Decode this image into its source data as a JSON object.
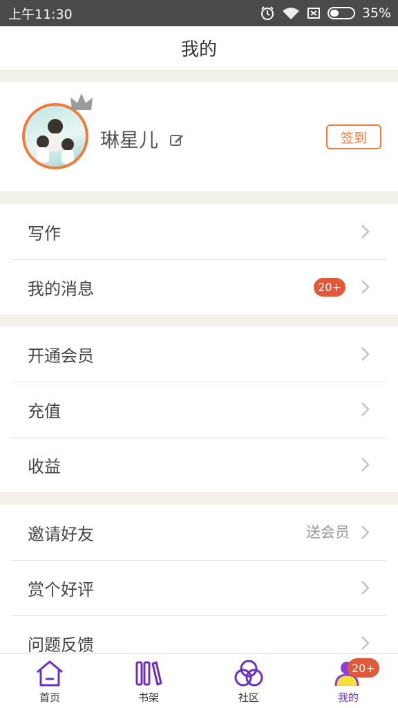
{
  "status_bar": {
    "time": "上午11:30",
    "battery": "35%",
    "icons": [
      "alarm-icon",
      "wifi-icon",
      "no-sim-icon",
      "battery-icon"
    ]
  },
  "header": {
    "title": "我的"
  },
  "profile": {
    "username": "琳星儿",
    "checkin_label": "签到"
  },
  "menu_groups": [
    {
      "items": [
        {
          "label": "写作"
        },
        {
          "label": "我的消息",
          "badge": "20+"
        }
      ]
    },
    {
      "items": [
        {
          "label": "开通会员"
        },
        {
          "label": "充值"
        },
        {
          "label": "收益"
        }
      ]
    },
    {
      "items": [
        {
          "label": "邀请好友",
          "extra": "送会员"
        },
        {
          "label": "赏个好评"
        },
        {
          "label": "问题反馈"
        }
      ]
    }
  ],
  "tab_bar": {
    "tabs": [
      {
        "label": "首页",
        "icon": "home-icon"
      },
      {
        "label": "书架",
        "icon": "bookshelf-icon"
      },
      {
        "label": "社区",
        "icon": "community-icon"
      },
      {
        "label": "我的",
        "icon": "profile-icon",
        "active": true
      }
    ],
    "profile_badge": "20+"
  },
  "colors": {
    "accent": "#f07b3b",
    "badge": "#e05a3a",
    "tab_active": "#6a2fbf",
    "background": "#f2f1ea"
  }
}
